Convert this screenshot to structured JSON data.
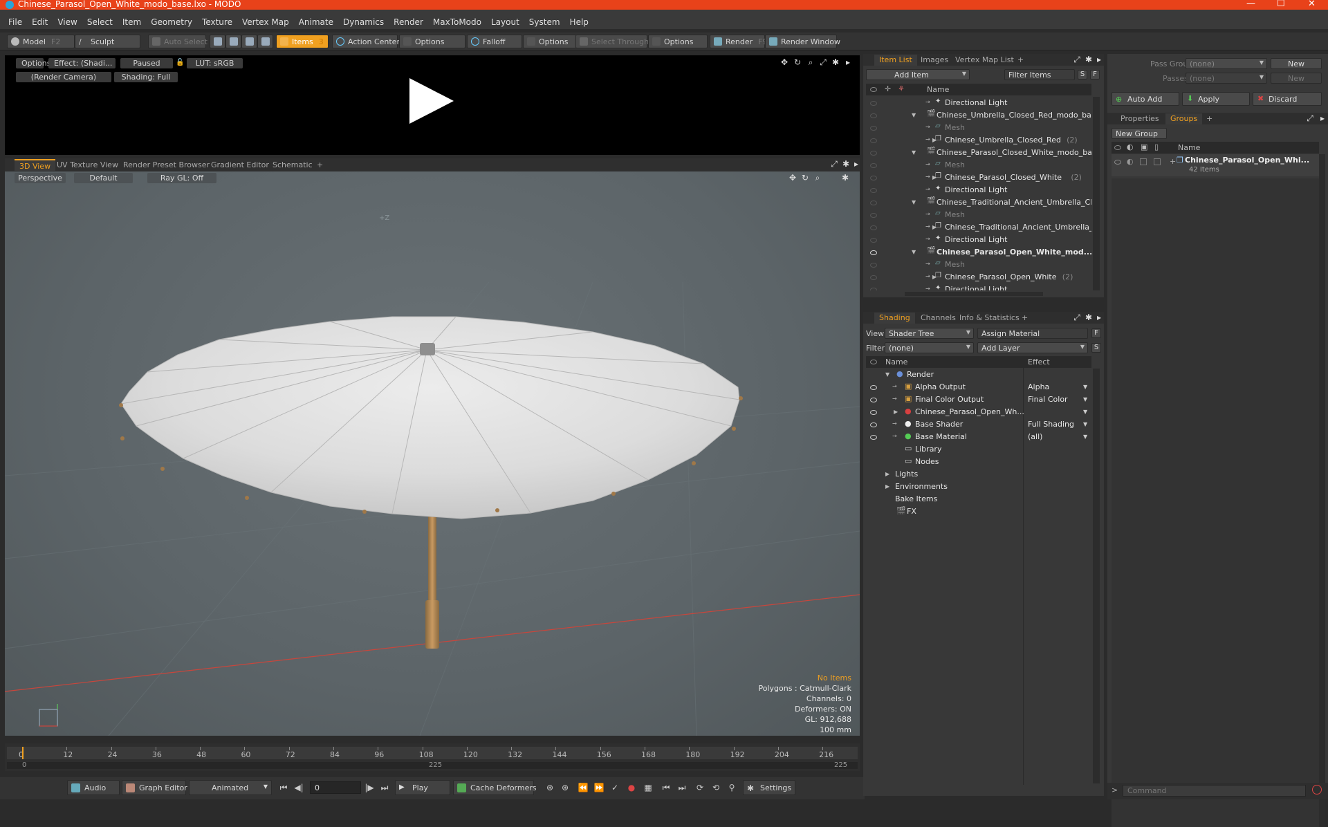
{
  "title_bar": {
    "title": "Chinese_Parasol_Open_White_modo_base.lxo - MODO",
    "minimize": "—",
    "maximize": "☐",
    "close": "✕"
  },
  "menu": [
    "File",
    "Edit",
    "View",
    "Select",
    "Item",
    "Geometry",
    "Texture",
    "Vertex Map",
    "Animate",
    "Dynamics",
    "Render",
    "MaxToModo",
    "Layout",
    "System",
    "Help"
  ],
  "toolbar": {
    "model": "Model",
    "model_key": "F2",
    "sculpt": "Sculpt",
    "auto_select": "Auto Select",
    "items": "Items",
    "items_key": "3",
    "action_center": "Action Center",
    "options1": "Options",
    "falloff": "Falloff",
    "options2": "Options",
    "select_through": "Select Through",
    "options3": "Options",
    "render": "Render",
    "render_key": "F9",
    "render_window": "Render Window"
  },
  "preview": {
    "options": "Options",
    "effect": "Effect: (Shadi...",
    "paused": "Paused",
    "lut": "LUT: sRGB",
    "camera": "(Render Camera)",
    "shading": "Shading: Full"
  },
  "viewport_tabs": [
    "3D View",
    "UV Texture View",
    "Render Preset Browser",
    "Gradient Editor",
    "Schematic",
    "+"
  ],
  "viewport": {
    "perspective": "Perspective",
    "default": "Default",
    "raygl": "Ray GL: Off",
    "hud": {
      "no_items": "No Items",
      "polygons": "Polygons : Catmull-Clark",
      "channels": "Channels: 0",
      "deformers": "Deformers: ON",
      "gl": "GL: 912,688",
      "scale": "100 mm"
    },
    "axis_label": "+Z"
  },
  "timeline": {
    "ticks": [
      "0",
      "12",
      "24",
      "36",
      "48",
      "60",
      "72",
      "84",
      "96",
      "108",
      "120",
      "132",
      "144",
      "156",
      "168",
      "180",
      "192",
      "204",
      "216"
    ],
    "start": "0",
    "mid": "225",
    "end": "225"
  },
  "transport": {
    "audio": "Audio",
    "graph_editor": "Graph Editor",
    "animated": "Animated",
    "frame": "0",
    "play": "Play",
    "cache_deformers": "Cache Deformers",
    "settings": "Settings"
  },
  "item_list": {
    "tabs": [
      "Item List",
      "Images",
      "Vertex Map List",
      "+"
    ],
    "add_item": "Add Item",
    "filter": "Filter Items",
    "s": "S",
    "f": "F",
    "col_name": "Name",
    "rows": [
      {
        "label": "Directional Light",
        "suffix": "",
        "indent": 2,
        "icon": "light",
        "tri": "",
        "bold": false,
        "dim": false
      },
      {
        "label": "Chinese_Umbrella_Closed_Red_modo_ba ...",
        "suffix": "",
        "indent": 0,
        "icon": "scene",
        "tri": "▼",
        "bold": false,
        "dim": false
      },
      {
        "label": "Mesh",
        "suffix": "",
        "indent": 2,
        "icon": "mesh",
        "tri": "",
        "bold": false,
        "dim": true
      },
      {
        "label": "Chinese_Umbrella_Closed_Red",
        "suffix": "(2)",
        "indent": 2,
        "icon": "group",
        "tri": "▶",
        "bold": false,
        "dim": false
      },
      {
        "label": "Chinese_Parasol_Closed_White_modo_ba...",
        "suffix": "",
        "indent": 0,
        "icon": "scene",
        "tri": "▼",
        "bold": false,
        "dim": false
      },
      {
        "label": "Mesh",
        "suffix": "",
        "indent": 2,
        "icon": "mesh",
        "tri": "",
        "bold": false,
        "dim": true
      },
      {
        "label": "Chinese_Parasol_Closed_White",
        "suffix": "(2)",
        "indent": 2,
        "icon": "group",
        "tri": "▶",
        "bold": false,
        "dim": false
      },
      {
        "label": "Directional Light",
        "suffix": "",
        "indent": 2,
        "icon": "light",
        "tri": "",
        "bold": false,
        "dim": false
      },
      {
        "label": "Chinese_Traditional_Ancient_Umbrella_Cl ...",
        "suffix": "",
        "indent": 0,
        "icon": "scene",
        "tri": "▼",
        "bold": false,
        "dim": false
      },
      {
        "label": "Mesh",
        "suffix": "",
        "indent": 2,
        "icon": "mesh",
        "tri": "",
        "bold": false,
        "dim": true
      },
      {
        "label": "Chinese_Traditional_Ancient_Umbrella_...",
        "suffix": "",
        "indent": 2,
        "icon": "group",
        "tri": "▶",
        "bold": false,
        "dim": false
      },
      {
        "label": "Directional Light",
        "suffix": "",
        "indent": 2,
        "icon": "light",
        "tri": "",
        "bold": false,
        "dim": false
      },
      {
        "label": "Chinese_Parasol_Open_White_mod...",
        "suffix": "",
        "indent": 0,
        "icon": "scene",
        "tri": "▼",
        "bold": true,
        "dim": false
      },
      {
        "label": "Mesh",
        "suffix": "",
        "indent": 2,
        "icon": "mesh",
        "tri": "",
        "bold": false,
        "dim": true
      },
      {
        "label": "Chinese_Parasol_Open_White",
        "suffix": "(2)",
        "indent": 2,
        "icon": "group",
        "tri": "▶",
        "bold": false,
        "dim": false
      },
      {
        "label": "Directional Light",
        "suffix": "",
        "indent": 2,
        "icon": "light",
        "tri": "",
        "bold": false,
        "dim": false
      }
    ]
  },
  "shading": {
    "tabs": [
      "Shading",
      "Channels",
      "Info & Statistics",
      "+"
    ],
    "view_label": "View",
    "view_value": "Shader Tree",
    "assign_material": "Assign Material",
    "filter_label": "Filter",
    "filter_value": "(none)",
    "add_layer": "Add Layer",
    "f": "F",
    "s": "S",
    "col_name": "Name",
    "col_effect": "Effect",
    "rows": [
      {
        "label": "Render",
        "effect": "",
        "indent": 0,
        "tri": "▼",
        "icon": "render",
        "eye": false
      },
      {
        "label": "Alpha Output",
        "effect": "Alpha",
        "indent": 1,
        "tri": "",
        "icon": "output",
        "eye": true
      },
      {
        "label": "Final Color Output",
        "effect": "Final Color",
        "indent": 1,
        "tri": "",
        "icon": "output",
        "eye": true
      },
      {
        "label": "Chinese_Parasol_Open_Wh...",
        "effect": "",
        "indent": 1,
        "tri": "▶",
        "icon": "material",
        "eye": true
      },
      {
        "label": "Base Shader",
        "effect": "Full Shading",
        "indent": 1,
        "tri": "",
        "icon": "shader",
        "eye": true
      },
      {
        "label": "Base Material",
        "effect": "(all)",
        "indent": 1,
        "tri": "",
        "icon": "basemat",
        "eye": true
      },
      {
        "label": "Library",
        "effect": "",
        "indent": 1,
        "tri": "",
        "icon": "folder",
        "eye": false
      },
      {
        "label": "Nodes",
        "effect": "",
        "indent": 1,
        "tri": "",
        "icon": "folder",
        "eye": false
      },
      {
        "label": "Lights",
        "effect": "",
        "indent": 0,
        "tri": "▶",
        "icon": "",
        "eye": false
      },
      {
        "label": "Environments",
        "effect": "",
        "indent": 0,
        "tri": "▶",
        "icon": "",
        "eye": false
      },
      {
        "label": "Bake Items",
        "effect": "",
        "indent": 0,
        "tri": "",
        "icon": "",
        "eye": false
      },
      {
        "label": "FX",
        "effect": "",
        "indent": 0,
        "tri": "",
        "icon": "fx",
        "eye": false
      }
    ]
  },
  "groups_panel": {
    "pass_groups_label": "Pass Groups",
    "pass_groups_value": "(none)",
    "new1": "New",
    "passes_label": "Passes",
    "passes_value": "(none)",
    "new2": "New",
    "auto_add": "Auto Add",
    "apply": "Apply",
    "discard": "Discard",
    "tabs": [
      "Properties",
      "Groups",
      "+"
    ],
    "new_group": "New Group",
    "col_name": "Name",
    "group_name": "Chinese_Parasol_Open_Whi...",
    "group_count": "42 Items",
    "command_placeholder": "Command"
  },
  "colors": {
    "accent": "#f0a020",
    "title_bar": "#e8421a",
    "x_axis": "#c8463c"
  }
}
